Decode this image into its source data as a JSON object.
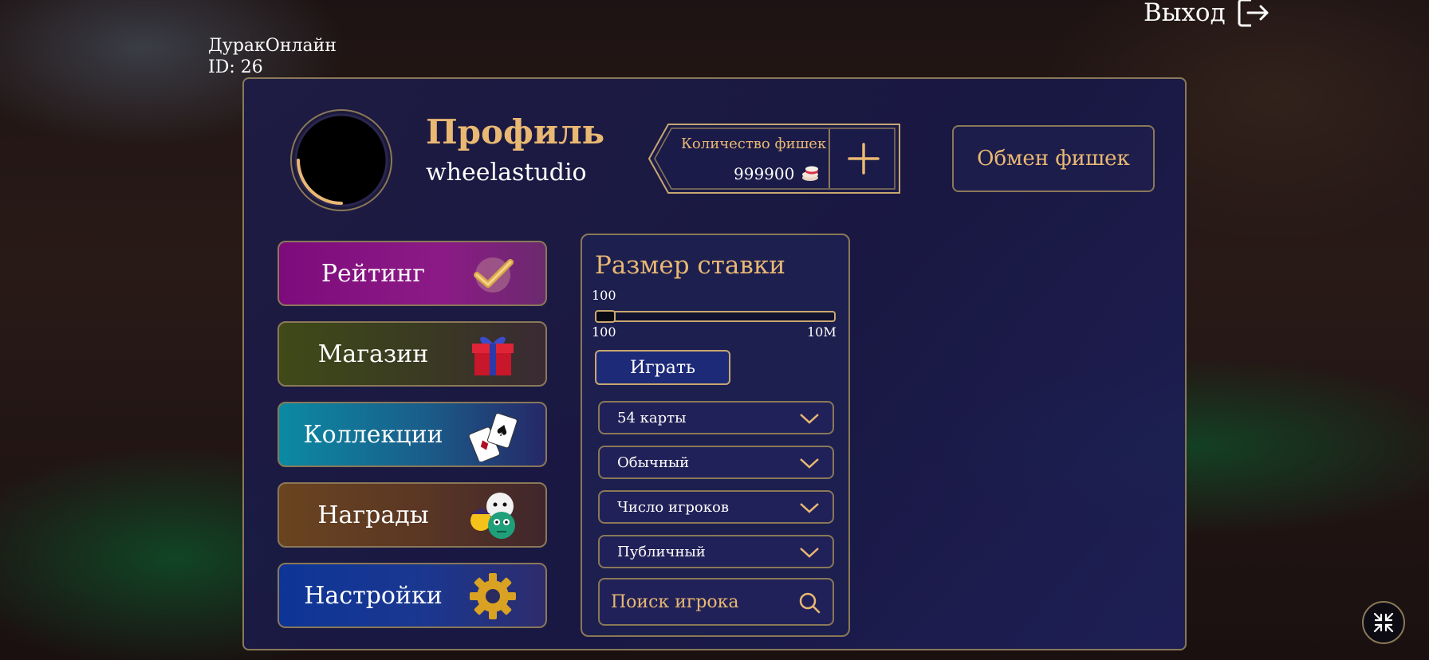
{
  "app": {
    "name": "ДуракОнлайн",
    "id_label": "ID: 26"
  },
  "header": {
    "exit_label": "Выход",
    "exit_icon": "logout-icon"
  },
  "profile": {
    "title": "Профиль",
    "username": "wheelastudio",
    "chips_label": "Количество фишек",
    "chips_value": "999900",
    "chips_icon": "chips-icon",
    "add_icon": "plus-icon",
    "exchange_label": "Обмен фишек"
  },
  "menu": {
    "items": [
      {
        "label": "Рейтинг",
        "icon": "checkmark-icon"
      },
      {
        "label": "Магазин",
        "icon": "gift-icon"
      },
      {
        "label": "Коллекции",
        "icon": "cards-icon"
      },
      {
        "label": "Награды",
        "icon": "emoji-icon"
      },
      {
        "label": "Настройки",
        "icon": "gear-icon"
      }
    ]
  },
  "bet": {
    "title": "Размер ставки",
    "current_value": "100",
    "min_label": "100",
    "max_label": "10M",
    "play_label": "Играть",
    "selects": [
      {
        "value": "54 карты"
      },
      {
        "value": "Обычный"
      },
      {
        "value": "Число игроков"
      },
      {
        "value": "Публичный"
      }
    ],
    "search_placeholder": "Поиск игрока"
  },
  "colors": {
    "accent_gold": "#e9b873",
    "border_gold": "#8a7858",
    "panel_bg": "#1e1c46",
    "rating": "#7d0b7b",
    "shop": "#3f4a18",
    "collections": "#0b8aa3",
    "awards": "#6a4420",
    "settings": "#0d3597"
  }
}
